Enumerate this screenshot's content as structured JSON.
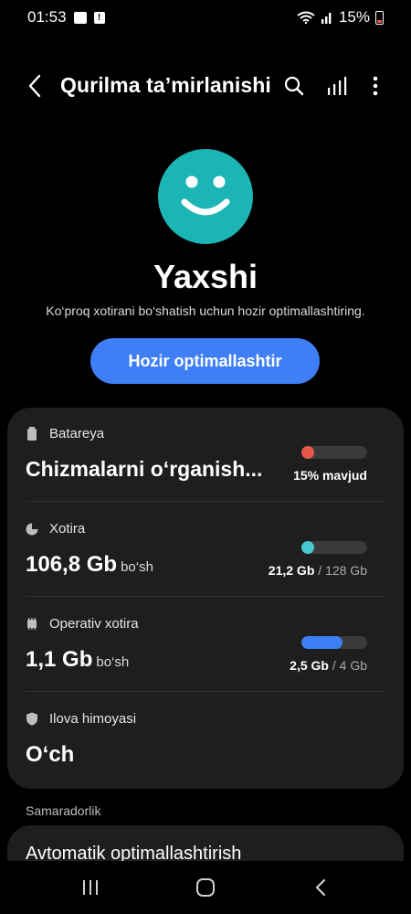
{
  "status_bar": {
    "time": "01:53",
    "battery_percent": "15%"
  },
  "header": {
    "title": "Qurilma ta’mirlanishi"
  },
  "summary": {
    "status": "Yaxshi",
    "message": "Ko‘proq xotirani bo‘shatish uchun hozir optimallashtiring.",
    "optimize_button": "Hozir optimallashtir",
    "face_color": "#1cb5b5"
  },
  "items": {
    "battery": {
      "label": "Batareya",
      "value": "Chizmalarni o‘rganish...",
      "caption": "15% mavjud",
      "level": 0.15,
      "color": "#e8584a"
    },
    "storage": {
      "label": "Xotira",
      "value": "106,8 Gb",
      "unit": "bo‘sh",
      "used": "21,2 Gb",
      "separator": " / ",
      "total": "128 Gb",
      "level": 0.17,
      "color": "#45c9cf"
    },
    "memory": {
      "label": "Operativ xotira",
      "value": "1,1 Gb",
      "unit": "bo‘sh",
      "used": "2,5 Gb",
      "separator": " / ",
      "total": "4 Gb",
      "level": 0.62,
      "color": "#3e7ff6"
    },
    "app_protection": {
      "label": "Ilova himoyasi",
      "value": "O‘ch"
    }
  },
  "performance": {
    "section_label": "Samaradorlik",
    "auto_optimize_label": "Avtomatik optimallashtirish"
  }
}
